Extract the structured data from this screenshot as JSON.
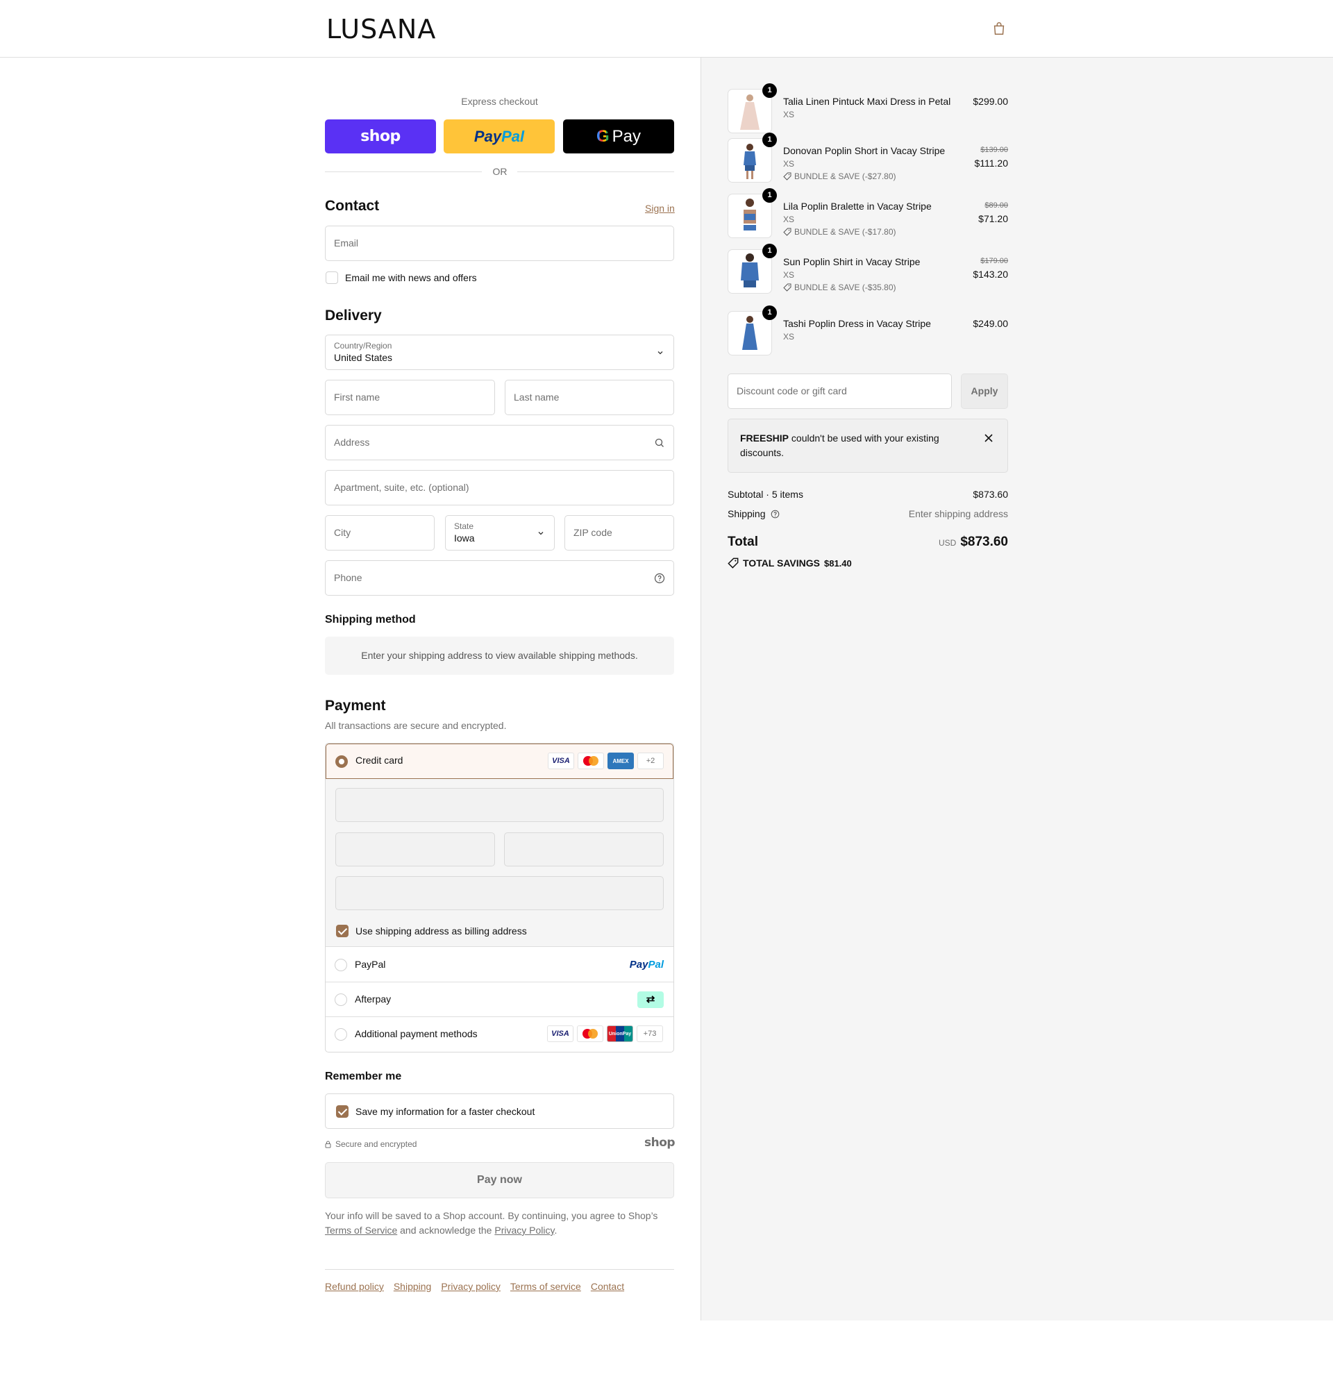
{
  "brand": {
    "name": "LUSANA"
  },
  "express": {
    "title": "Express checkout",
    "shop_label": "shop",
    "paypal_label_a": "Pay",
    "paypal_label_b": "Pal",
    "gpay_g": "G",
    "gpay_label": "Pay",
    "or_label": "OR"
  },
  "contact": {
    "heading": "Contact",
    "signin_label": "Sign in",
    "email_placeholder": "Email",
    "newsletter_label": "Email me with news and offers"
  },
  "delivery": {
    "heading": "Delivery",
    "country_label": "Country/Region",
    "country_value": "United States",
    "first_name_placeholder": "First name",
    "last_name_placeholder": "Last name",
    "address_placeholder": "Address",
    "apartment_placeholder": "Apartment, suite, etc. (optional)",
    "city_placeholder": "City",
    "state_label": "State",
    "state_value": "Iowa",
    "zip_placeholder": "ZIP code",
    "phone_placeholder": "Phone"
  },
  "shipping_method": {
    "heading": "Shipping method",
    "message": "Enter your shipping address to view available shipping methods."
  },
  "payment": {
    "heading": "Payment",
    "note": "All transactions are secure and encrypted.",
    "credit_card_label": "Credit card",
    "cc_badges": [
      "VISA",
      "AMEX",
      "+2"
    ],
    "billing_label": "Use shipping address as billing address",
    "paypal_label": "PayPal",
    "paypal_logo_a": "Pay",
    "paypal_logo_b": "Pal",
    "afterpay_label": "Afterpay",
    "afterpay_logo": "⇄",
    "additional_label": "Additional payment methods",
    "additional_badges": [
      "VISA",
      "UnionPay",
      "+73"
    ]
  },
  "remember": {
    "heading": "Remember me",
    "save_label": "Save my information for a faster checkout",
    "secure_label": "Secure and encrypted",
    "shop_label": "shop"
  },
  "pay_now_label": "Pay now",
  "legal": {
    "text_a": "Your info will be saved to a Shop account. By continuing, you agree to Shop’s",
    "terms_label": "Terms of Service",
    "text_b": "and acknowledge the",
    "privacy_label": "Privacy Policy",
    "text_c": "."
  },
  "footer": {
    "links": [
      "Refund policy",
      "Shipping",
      "Privacy policy",
      "Terms of service",
      "Contact"
    ]
  },
  "summary": {
    "items": [
      {
        "qty": "1",
        "name": "Talia Linen Pintuck Maxi Dress in Petal",
        "variant": "XS",
        "price": "$299.00",
        "color": "#ecd3c9"
      },
      {
        "qty": "1",
        "name": "Donovan Poplin Short in Vacay Stripe",
        "variant": "XS",
        "discount": "BUNDLE & SAVE (-$27.80)",
        "original": "$139.00",
        "price": "$111.20",
        "color": "#3f72b8"
      },
      {
        "qty": "1",
        "name": "Lila Poplin Bralette in Vacay Stripe",
        "variant": "XS",
        "discount": "BUNDLE & SAVE (-$17.80)",
        "original": "$89.00",
        "price": "$71.20",
        "color": "#3f72b8"
      },
      {
        "qty": "1",
        "name": "Sun Poplin Shirt in Vacay Stripe",
        "variant": "XS",
        "discount": "BUNDLE & SAVE (-$35.80)",
        "original": "$179.00",
        "price": "$143.20",
        "color": "#3f72b8"
      },
      {
        "qty": "1",
        "name": "Tashi Poplin Dress in Vacay Stripe",
        "variant": "XS",
        "price": "$249.00",
        "color": "#3f72b8"
      }
    ],
    "discount_placeholder": "Discount code or gift card",
    "apply_label": "Apply",
    "notice_code": "FREESHIP",
    "notice_text": "couldn't be used with your existing discounts.",
    "subtotal_label": "Subtotal · 5 items",
    "subtotal_value": "$873.60",
    "shipping_label": "Shipping",
    "shipping_value": "Enter shipping address",
    "total_label": "Total",
    "currency": "USD",
    "total_value": "$873.60",
    "savings_label": "TOTAL SAVINGS",
    "savings_value": "$81.40"
  },
  "colors": {
    "accent": "#9b7250",
    "shop_purple": "#5a31f4",
    "paypal_yellow": "#ffc439"
  }
}
